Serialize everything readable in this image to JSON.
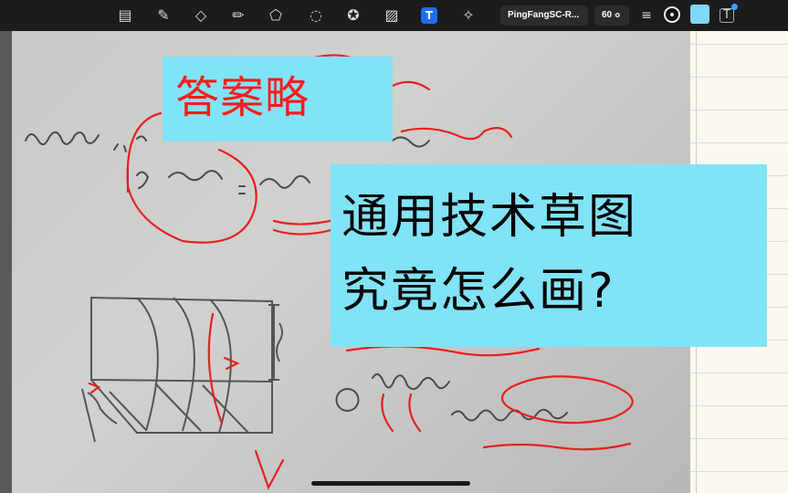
{
  "toolbar": {
    "tools": [
      {
        "name": "text-box-icon",
        "glyph": "▤"
      },
      {
        "name": "pen-icon",
        "glyph": "✎"
      },
      {
        "name": "eraser-icon",
        "glyph": "◇"
      },
      {
        "name": "highlighter-icon",
        "glyph": "✏"
      },
      {
        "name": "shapes-icon",
        "glyph": "⬠"
      },
      {
        "name": "lasso-icon",
        "glyph": "◌"
      },
      {
        "name": "sticker-icon",
        "glyph": "✪"
      },
      {
        "name": "image-icon",
        "glyph": "▨"
      },
      {
        "name": "text-tool-icon",
        "glyph": "T"
      },
      {
        "name": "laser-pointer-icon",
        "glyph": "✧"
      }
    ],
    "font_name": "PingFangSC-R...",
    "font_size": "60",
    "align_icon": "≡",
    "text_color": "#111111",
    "fill_color": "#7fd8f5",
    "textbox_icon": "T"
  },
  "stickers": {
    "answer_omitted": "答案略",
    "title_line1": "通用技术草图",
    "title_line2": "究竟怎么画?"
  },
  "colors": {
    "sticker_bg": "#81e3f7",
    "red_text": "#ff1a1a",
    "ink": "#3a3a3a",
    "annotation_red": "#e8201f"
  }
}
